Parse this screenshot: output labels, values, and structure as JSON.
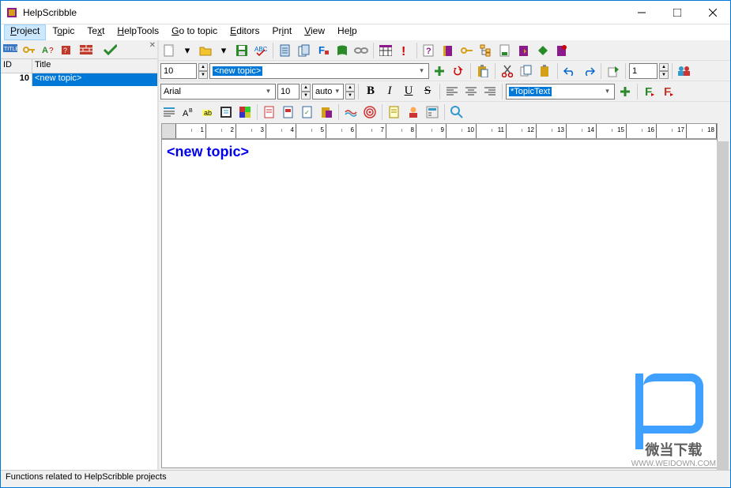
{
  "window": {
    "title": "HelpScribble"
  },
  "menu": {
    "project": "Project",
    "topic": "Topic",
    "text": "Text",
    "helptools": "HelpTools",
    "goto": "Go to topic",
    "editors": "Editors",
    "print": "Print",
    "view": "View",
    "help": "Help"
  },
  "sidebar": {
    "head_id": "ID",
    "head_title": "Title",
    "row": {
      "id": "10",
      "title": "<new topic>"
    }
  },
  "topicbar": {
    "id_value": "10",
    "topic_sel": "<new topic>",
    "page_value": "1"
  },
  "format": {
    "font": "Arial",
    "size": "10",
    "auto": "auto",
    "style_sel": "*TopicText"
  },
  "editor": {
    "heading": "<new topic>"
  },
  "status": {
    "text": "Functions related to HelpScribble projects"
  },
  "ruler": [
    "1",
    "2",
    "3",
    "4",
    "5",
    "6",
    "7",
    "8",
    "9",
    "10",
    "11",
    "12",
    "13",
    "14",
    "15",
    "16",
    "17",
    "18"
  ],
  "watermark": {
    "line1": "微当下载",
    "line2": "WWW.WEIDOWN.COM"
  }
}
